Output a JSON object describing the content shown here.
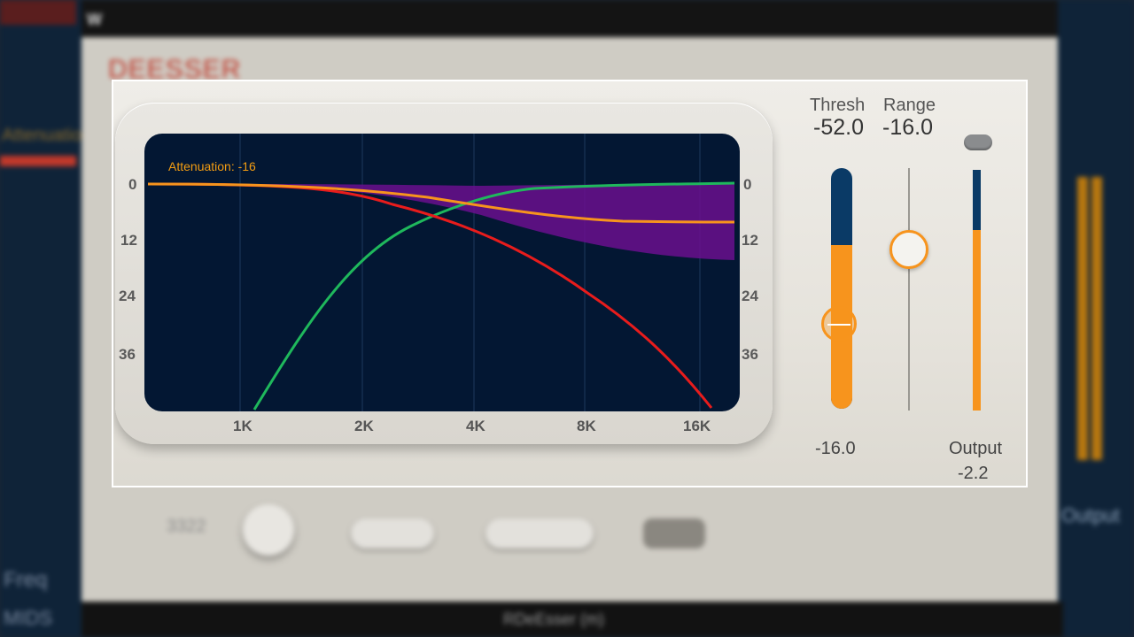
{
  "background": {
    "host_logo": "W",
    "plugin_title": "DEESSER",
    "left_labels": [
      "Attenuation",
      "Freq",
      "MIDS"
    ],
    "right_label": "Output",
    "knob_value": "3322",
    "bottom_title": "RDeEsser (m)"
  },
  "graph": {
    "attenuation_label": "Attenuation: -16",
    "y_ticks_left": [
      "0",
      "12",
      "24",
      "36"
    ],
    "y_ticks_right": [
      "0",
      "12",
      "24",
      "36"
    ],
    "x_ticks": [
      "1K",
      "2K",
      "4K",
      "8K",
      "16K"
    ],
    "colors": {
      "background": "#031733",
      "attenuation_curve": "#f7941d",
      "lowpass_curve": "#e81c1c",
      "highpass_curve": "#1fb85c",
      "range_fill": "#6a0f8e"
    }
  },
  "controls": {
    "thresh": {
      "label": "Thresh",
      "value": "-52.0",
      "level": 0.68
    },
    "range": {
      "label": "Range",
      "value": "-16.0",
      "level": 0.66
    },
    "thresh_readout": "-16.0",
    "output": {
      "label": "Output",
      "value": "-2.2",
      "level": 0.75
    }
  }
}
